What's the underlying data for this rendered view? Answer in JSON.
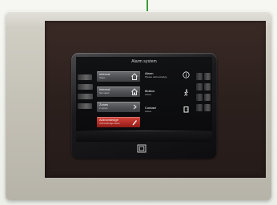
{
  "device": {
    "screen_title": "Alarm system",
    "menu_tiles": [
      {
        "label": "Internal",
        "sub": "Steps",
        "icon": "house-icon",
        "style": "gray"
      },
      {
        "label": "Internal",
        "sub": "Set steps",
        "icon": "house-lock-icon",
        "style": "gray"
      },
      {
        "label": "Zones",
        "sub": "2 zones",
        "icon": "chevron-right-icon",
        "style": "gray"
      },
      {
        "label": "Acknowledge",
        "sub": "Acknowledge alarm",
        "icon": "pencil-icon",
        "style": "red"
      }
    ],
    "status_items": [
      {
        "label": "Alarm",
        "sub": "Please acknowledge",
        "icon": "info-icon"
      },
      {
        "label": "Motion",
        "sub": "Active",
        "icon": "walking-person-icon"
      },
      {
        "label": "Contact",
        "sub": "Active",
        "icon": "door-contact-icon"
      }
    ],
    "footer": {
      "icon": "home-square-icon"
    },
    "colors": {
      "wall_plate": "#c8c6bc",
      "dark_panel": "#2e221f",
      "screen_bg": "#0c0c0e",
      "alarm_red": "#c0322c",
      "wire_green": "#3a9e3a"
    }
  }
}
